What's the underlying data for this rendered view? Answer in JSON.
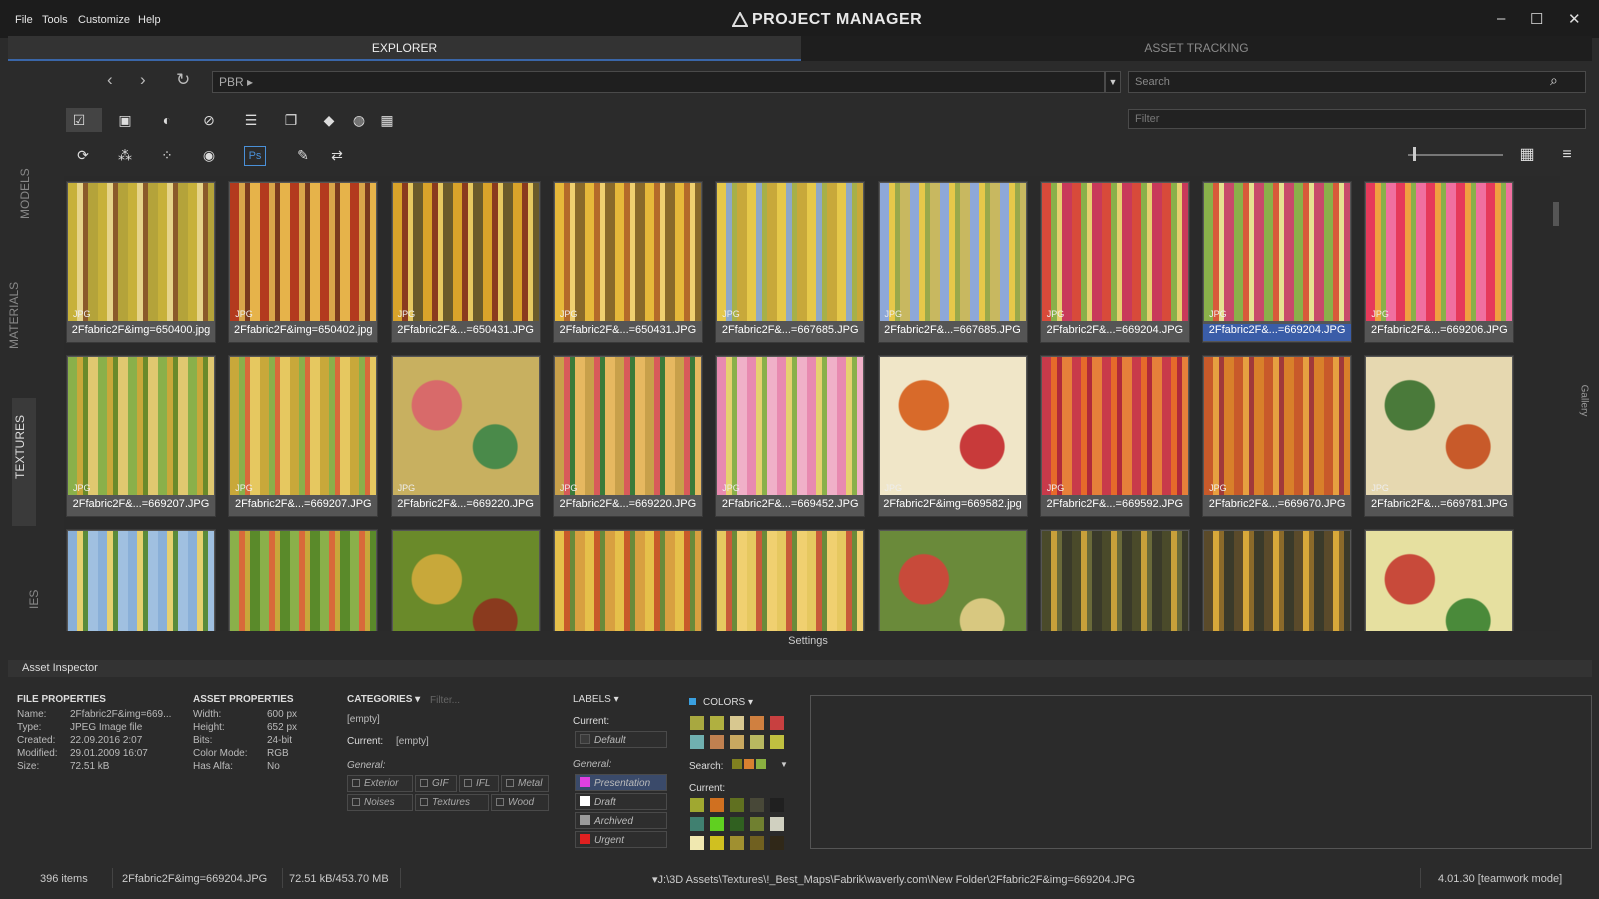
{
  "menu": [
    "File",
    "Tools",
    "Customize",
    "Help"
  ],
  "app_title": "PROJECT MANAGER",
  "window_controls": {
    "minimize": "–",
    "maximize": "☐",
    "close": "✕"
  },
  "tabs": [
    {
      "label": "EXPLORER"
    },
    {
      "label": "ASSET TRACKING"
    }
  ],
  "path": {
    "value": "PBR ▸"
  },
  "search": {
    "placeholder": "Search"
  },
  "filter": {
    "placeholder": "Filter"
  },
  "side_tabs": [
    "MODELS",
    "MATERIALS",
    "TEXTURES",
    "IES"
  ],
  "gallery_label": "Gallery",
  "settings_label": "Settings",
  "grid": [
    {
      "name": "2Ffabric2F&img=650400.jpg",
      "type": "JPG",
      "colors": [
        "#c7b13a",
        "#e6d48a",
        "#8a5a2a",
        "#b4a33a"
      ]
    },
    {
      "name": "2Ffabric2F&img=650402.jpg",
      "type": "JPG",
      "colors": [
        "#b33a1e",
        "#d9a64a",
        "#7a3a1e",
        "#e6b34a"
      ]
    },
    {
      "name": "2Ffabric2F&...=650431.JPG",
      "type": "JPG",
      "colors": [
        "#d9a32a",
        "#8a3a1e",
        "#e6c860",
        "#6a5a2a"
      ]
    },
    {
      "name": "2Ffabric2F&...=650431.JPG",
      "type": "JPG",
      "colors": [
        "#e6b83a",
        "#b36a2a",
        "#f0d070",
        "#8a6a2a"
      ]
    },
    {
      "name": "2Ffabric2F&...=667685.JPG",
      "type": "JPG",
      "colors": [
        "#e6c84a",
        "#8ea8c8",
        "#a6b04a",
        "#c8a83a"
      ]
    },
    {
      "name": "2Ffabric2F&...=667685.JPG",
      "type": "JPG",
      "colors": [
        "#8ea8d8",
        "#e6c84a",
        "#9aa84a",
        "#c8b860"
      ]
    },
    {
      "name": "2Ffabric2F&...=669204.JPG",
      "type": "JPG",
      "colors": [
        "#d84a3a",
        "#8ab04a",
        "#e6d070",
        "#c83a5a"
      ]
    },
    {
      "name": "2Ffabric2F&...=669204.JPG",
      "type": "JPG",
      "colors": [
        "#8ab04a",
        "#d85a3a",
        "#e6e090",
        "#c84a6a"
      ],
      "selected": true
    },
    {
      "name": "2Ffabric2F&...=669206.JPG",
      "type": "JPG",
      "colors": [
        "#e63a5a",
        "#f0a040",
        "#8ab04a",
        "#f070a0"
      ]
    },
    {
      "name": "2Ffabric2F&...=669207.JPG",
      "type": "JPG",
      "colors": [
        "#8ab04a",
        "#c8a83a",
        "#6a8a2a",
        "#e0c870"
      ]
    },
    {
      "name": "2Ffabric2F&...=669207.JPG",
      "type": "JPG",
      "colors": [
        "#c8a83a",
        "#8ab04a",
        "#d86a3a",
        "#e6c860"
      ]
    },
    {
      "name": "2Ffabric2F&...=669220.JPG",
      "type": "JPG",
      "colors": [
        "#c8b060",
        "#d86a6a",
        "#4a8a4a",
        "#e6c880"
      ]
    },
    {
      "name": "2Ffabric2F&...=669220.JPG",
      "type": "JPG",
      "colors": [
        "#c8a04a",
        "#d85a5a",
        "#3a7a3a",
        "#e6b860"
      ]
    },
    {
      "name": "2Ffabric2F&...=669452.JPG",
      "type": "JPG",
      "colors": [
        "#e88ab0",
        "#e6d070",
        "#8ab04a",
        "#f0b0c8"
      ]
    },
    {
      "name": "2Ffabric2F&img=669582.jpg",
      "type": "JPG",
      "colors": [
        "#f0e6c8",
        "#d86a2a",
        "#c83a3a",
        "#8aa84a"
      ]
    },
    {
      "name": "2Ffabric2F&...=669592.JPG",
      "type": "JPG",
      "colors": [
        "#c83a4a",
        "#e66a2a",
        "#b02a3a",
        "#e6803a"
      ]
    },
    {
      "name": "2Ffabric2F&...=669670.JPG",
      "type": "JPG",
      "colors": [
        "#c85a2a",
        "#e6a040",
        "#a03a3a",
        "#d8802a"
      ]
    },
    {
      "name": "2Ffabric2F&...=669781.JPG",
      "type": "JPG",
      "colors": [
        "#e6d8b0",
        "#4a7a3a",
        "#c85a2a",
        "#d8c890"
      ]
    },
    {
      "name": "",
      "type": "",
      "colors": [
        "#8ab0d8",
        "#e6d070",
        "#5a8a3a",
        "#a0c0e0"
      ]
    },
    {
      "name": "",
      "type": "",
      "colors": [
        "#8ab04a",
        "#d86a3a",
        "#c8a83a",
        "#5a8a2a"
      ]
    },
    {
      "name": "",
      "type": "",
      "colors": [
        "#6a8a2a",
        "#c8a83a",
        "#8a3a1e",
        "#d8b860"
      ]
    },
    {
      "name": "",
      "type": "",
      "colors": [
        "#e6c04a",
        "#c85a2a",
        "#6a8a3a",
        "#d8a040"
      ]
    },
    {
      "name": "",
      "type": "",
      "colors": [
        "#e6c860",
        "#c85a3a",
        "#6a8a3a",
        "#f0d070"
      ]
    },
    {
      "name": "",
      "type": "",
      "colors": [
        "#6a8a3a",
        "#c84a3a",
        "#d8c880",
        "#4a6a2a"
      ]
    },
    {
      "name": "",
      "type": "",
      "colors": [
        "#4a4a2a",
        "#c8a03a",
        "#6a6a3a",
        "#3a3a2a"
      ]
    },
    {
      "name": "",
      "type": "",
      "colors": [
        "#5a4a2a",
        "#d8a83a",
        "#8a6a2a",
        "#3a3a2a"
      ]
    },
    {
      "name": "",
      "type": "",
      "colors": [
        "#e6e0a0",
        "#c84a3a",
        "#4a8a3a",
        "#f0e8c0"
      ]
    }
  ],
  "inspector": {
    "title": "Asset Inspector",
    "file_props": {
      "header": "FILE PROPERTIES",
      "rows": [
        [
          "Name:",
          "2Ffabric2F&img=669..."
        ],
        [
          "Type:",
          "JPEG Image file"
        ],
        [
          "Created:",
          "22.09.2016 2:07"
        ],
        [
          "Modified:",
          "29.01.2009 16:07"
        ],
        [
          "Size:",
          "72.51 kB"
        ]
      ]
    },
    "asset_props": {
      "header": "ASSET PROPERTIES",
      "rows": [
        [
          "Width:",
          "600 px"
        ],
        [
          "Height:",
          "652 px"
        ],
        [
          "Bits:",
          "24-bit"
        ],
        [
          "Color Mode:",
          "RGB"
        ],
        [
          "Has Alfa:",
          "No"
        ]
      ]
    },
    "categories": {
      "header": "CATEGORIES ▾",
      "filter_placeholder": "Filter...",
      "empty": "[empty]",
      "current_label": "Current:",
      "current_value": "[empty]",
      "general_label": "General:",
      "items": [
        "Exterior",
        "GIF",
        "IFL",
        "Metal",
        "Noises",
        "Textures",
        "Wood"
      ]
    },
    "labels": {
      "header": "LABELS ▾",
      "current_label": "Current:",
      "default": "Default",
      "general_label": "General:",
      "items": [
        {
          "name": "Presentation",
          "color": "#e040e0"
        },
        {
          "name": "Draft",
          "color": "#ffffff"
        },
        {
          "name": "Archived",
          "color": "#9a9a9a"
        },
        {
          "name": "Urgent",
          "color": "#e02020"
        }
      ]
    },
    "colors": {
      "header": "COLORS ▾",
      "search_label": "Search:",
      "current_label": "Current:",
      "palette": [
        "#a8a840",
        "#b0b040",
        "#d8c890",
        "#d08040",
        "#c84040",
        "#70b0b0",
        "#c08050",
        "#c8a860",
        "#b8b860",
        "#c0c040"
      ],
      "search": [
        "#808020",
        "#d88030",
        "#8ab040"
      ],
      "current": [
        "#a0a830",
        "#d07020",
        "#607020",
        "#484838",
        "#202020",
        "#408070",
        "#60d020",
        "#306020",
        "#708030",
        "#d0d0c0",
        "#f0e8b0",
        "#d0c020",
        "#a09030",
        "#706020",
        "#302818"
      ]
    }
  },
  "status": {
    "items": "396 items",
    "file": "2Ffabric2F&img=669204.JPG",
    "size": "72.51 kB/453.70 MB",
    "path": "▾J:\\3D Assets\\Textures\\!_Best_Maps\\Fabrik\\waverly.com\\New Folder\\2Ffabric2F&img=669204.JPG",
    "version": "4.01.30 [teamwork mode]"
  }
}
